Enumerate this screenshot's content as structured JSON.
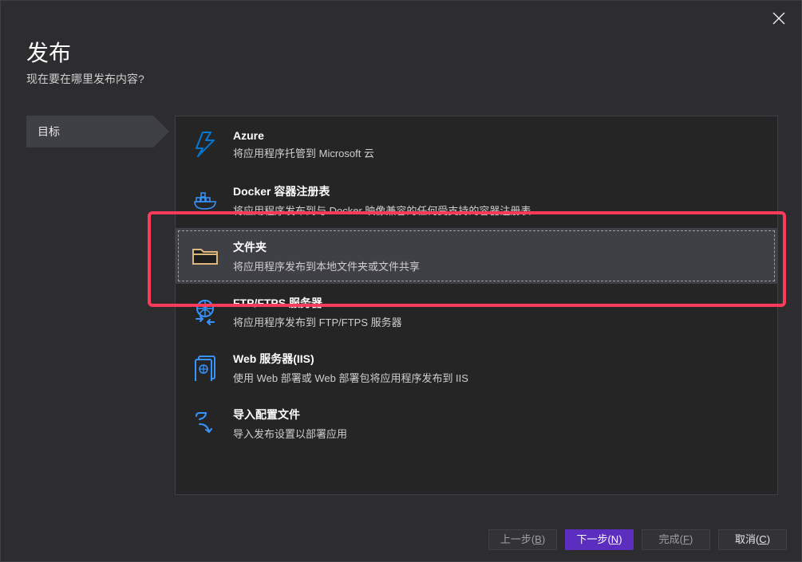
{
  "title": "发布",
  "subtitle": "现在要在哪里发布内容?",
  "steps": {
    "target_label": "目标"
  },
  "options": {
    "azure": {
      "title": "Azure",
      "desc": "将应用程序托管到 Microsoft 云"
    },
    "docker": {
      "title": "Docker 容器注册表",
      "desc": "将应用程序发布到与 Docker 映像兼容的任何受支持的容器注册表"
    },
    "folder": {
      "title": "文件夹",
      "desc": "将应用程序发布到本地文件夹或文件共享"
    },
    "ftp": {
      "title": "FTP/FTPS 服务器",
      "desc": "将应用程序发布到 FTP/FTPS 服务器"
    },
    "iis": {
      "title": "Web 服务器(IIS)",
      "desc": "使用 Web 部署或 Web 部署包将应用程序发布到 IIS"
    },
    "import": {
      "title": "导入配置文件",
      "desc": "导入发布设置以部署应用"
    }
  },
  "buttons": {
    "back_prefix": "上一步(",
    "back_mnemonic": "B",
    "back_suffix": ")",
    "next_prefix": "下一步(",
    "next_mnemonic": "N",
    "next_suffix": ")",
    "finish_prefix": "完成(",
    "finish_mnemonic": "F",
    "finish_suffix": ")",
    "cancel_prefix": "取消(",
    "cancel_mnemonic": "C",
    "cancel_suffix": ")"
  },
  "colors": {
    "accent": "#5b2ec0",
    "highlight": "#ff3b5c",
    "azure_icon": "#0078d4",
    "folder_icon": "#dcb67a",
    "line_icon": "#3794ff"
  }
}
